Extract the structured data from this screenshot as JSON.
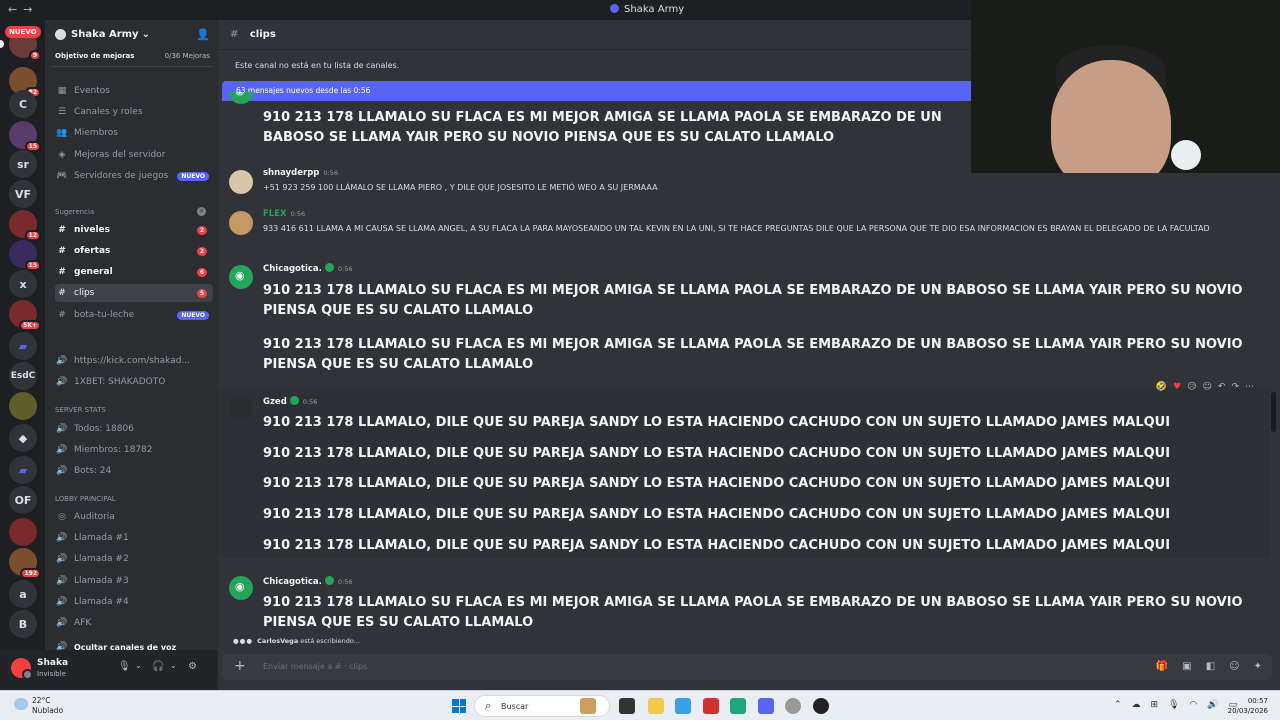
{
  "window": {
    "title": "Shaka Army"
  },
  "rail": {
    "nuevo": "NUEVO",
    "servers": [
      {
        "label": "",
        "badge": "9"
      },
      {
        "label": "",
        "badge": "82"
      },
      {
        "label": "C",
        "badge": ""
      },
      {
        "label": "",
        "badge": "15"
      },
      {
        "label": "sr",
        "badge": ""
      },
      {
        "label": "VF",
        "badge": ""
      },
      {
        "label": "",
        "badge": "12"
      },
      {
        "label": "",
        "badge": "15"
      },
      {
        "label": "x",
        "badge": ""
      },
      {
        "label": "",
        "badge": "5K+"
      },
      {
        "label": "",
        "badge": ""
      },
      {
        "label": "EsdC",
        "badge": ""
      },
      {
        "label": "",
        "badge": ""
      },
      {
        "label": "",
        "badge": ""
      },
      {
        "label": "",
        "badge": ""
      },
      {
        "label": "OF",
        "badge": ""
      },
      {
        "label": "",
        "badge": ""
      },
      {
        "label": "",
        "badge": "192"
      },
      {
        "label": "a",
        "badge": ""
      },
      {
        "label": "B",
        "badge": ""
      }
    ]
  },
  "guild": {
    "name": "Shaka Army",
    "goal_label": "Objetivo de mejoras",
    "goal_progress": "0/36 Mejoras",
    "goal_fraction": 0
  },
  "sidebar": {
    "top_items": [
      "Eventos",
      "Canales y roles",
      "Miembros",
      "Mejoras del servidor",
      "Servidores de juegos"
    ],
    "new_tag": "NUEVO",
    "category_suggest": "Sugerencia",
    "suggested": [
      {
        "name": "niveles",
        "count": "2"
      },
      {
        "name": "ofertas",
        "count": "2"
      },
      {
        "name": "general",
        "count": "6"
      },
      {
        "name": "clips",
        "count": "5"
      },
      {
        "name": "bota-tu-leche",
        "count": ""
      }
    ],
    "links": [
      "https://kick.com/shakad...",
      "1XBET: SHAKADOTO"
    ],
    "category_stats": "SERVER STATS",
    "stats": [
      "Todos: 18806",
      "Miembros: 18782",
      "Bots: 24"
    ],
    "category_lobby": "LOBBY PRINCIPAL",
    "voice": [
      "Auditoria",
      "Llamada #1",
      "Llamada #2",
      "Llamada #3",
      "Llamada #4",
      "AFK"
    ],
    "hide_voice": "Ocultar canales de voz"
  },
  "user": {
    "name": "Shaka",
    "status": "Invisible"
  },
  "channel": {
    "name": "clips",
    "notice": "Este canal no está en tu lista de canales.",
    "new_messages": "63 mensajes nuevos desde las 0:56"
  },
  "messages": {
    "first_big": "910 213 178 LLAMALO SU FLACA ES MI MEJOR AMIGA SE LLAMA PAOLA SE EMBARAZO DE UN BABOSO SE LLAMA YAIR PERO SU NOVIO PIENSA QUE ES SU CALATO LLAMALO",
    "shnay_name": "shnayderpp",
    "shnay_time": "0:56",
    "shnay_text": "+51 923 259 100 LLÁMALO SE LLAMA PIERO , Y DILE QUE JOSESITO LE METIÓ WEO A SU JERMAAA",
    "flex_name": "FLEX",
    "flex_time": "0:56",
    "flex_text": "933 416 611 LLAMA A MI CAUSA SE LLAMA ANGEL, A SU FLACA LA PARA MAYOSEANDO UN  TAL KEVIN EN LA UNI,  SI TE HACE PREGUNTAS DILE  QUE  LA PERSONA QUE TE DIO ESA INFORMACION ES BRAYAN EL DELEGADO DE LA FACULTAD",
    "chica_name": "Chicagotica.",
    "chica_time": "0:56",
    "chica_text": "910 213 178 LLAMALO SU FLACA ES MI MEJOR AMIGA SE LLAMA PAOLA SE EMBARAZO DE UN BABOSO SE LLAMA YAIR PERO SU NOVIO PIENSA QUE ES SU CALATO LLAMALO",
    "gzed_name": "Gzed",
    "gzed_time": "0:56",
    "gzed_text": "910 213 178 LLAMALO, DILE QUE SU PAREJA SANDY LO ESTA HACIENDO CACHUDO CON UN SUJETO LLAMADO JAMES MALQUI",
    "chica2_name": "Chicagotica.",
    "chica2_time": "0:56",
    "chica2_text": "910 213 178 LLAMALO SU FLACA ES MI MEJOR AMIGA SE LLAMA PAOLA SE EMBARAZO DE UN BABOSO SE LLAMA YAIR PERO SU NOVIO PIENSA QUE ES SU CALATO LLAMALO"
  },
  "typing": {
    "user": "CarlosVega",
    "text": "está escribiendo..."
  },
  "composer": {
    "placeholder": "Enviar mensaje a #  · clips"
  },
  "taskbar": {
    "temp": "22°C",
    "weather": "Nublado",
    "search": "Buscar",
    "time": "00:57",
    "date": "20/03/2026"
  },
  "colors": {
    "accent": "#5865f2",
    "danger": "#f23f43",
    "online": "#23a55a"
  }
}
